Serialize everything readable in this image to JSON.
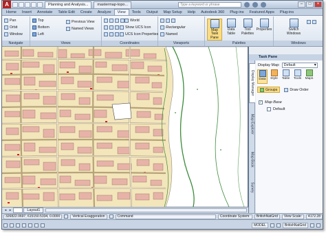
{
  "window": {
    "qat_logo": "A",
    "tab_planning": "Planning and Analysis...",
    "tab_doc": "mastermap-topo...",
    "search_placeholder": "Type a keyword or phrase"
  },
  "ribbon_tabs": [
    "Home",
    "Insert",
    "Annotate",
    "Table Edit",
    "Create",
    "Analyze",
    "View",
    "Tools",
    "Output",
    "Map Setup",
    "Help",
    "Autodesk 360",
    "Plug-ins",
    "Featured Apps",
    "Plug-ins"
  ],
  "ribbon_active_tab": "View",
  "navigate": {
    "label": "Navigate",
    "pan": "Pan",
    "orbit": "Orbit",
    "window": "Window"
  },
  "views": {
    "label": "Views",
    "top": "Top",
    "bottom": "Bottom",
    "left": "Left",
    "previous_view": "Previous View",
    "named_views": "Named Views"
  },
  "coordinates": {
    "label": "Coordinates",
    "world": "World",
    "show_ucs_icon": "Show UCS Icon",
    "ucs_icon_properties": "UCS Icon Properties"
  },
  "viewports": {
    "label": "Viewports",
    "rectangular": "Rectangular",
    "named": "Named"
  },
  "palettes": {
    "label": "Palettes",
    "map_task_pane": "Map Task Pane",
    "data_table": "Data Table",
    "tool_palettes": "Tool Palettes",
    "properties": "Properties"
  },
  "windows": {
    "label": "Windows",
    "switch_windows": "Switch Windows"
  },
  "layout_tabs": [
    "Layout1"
  ],
  "task_pane": {
    "title": "Task Pane",
    "side_tabs": [
      "Display Manager",
      "Map Explorer",
      "Map Book",
      "Survey"
    ],
    "display_map_label": "Display Map:",
    "display_map_value": "Default",
    "tools": [
      "Data",
      "Style",
      "Table",
      "Tools",
      "Maps"
    ],
    "groups_button": "Groups",
    "draw_order_button": "Draw Order",
    "tree": [
      {
        "label": "Map Base",
        "checked": true
      },
      {
        "label": "Default",
        "checked": false
      }
    ]
  },
  "command_line": {
    "coords": "326822.0697, 615150.5334, 0.0000",
    "vertical_exaggeration": "Vertical Exaggeration",
    "command": "Command",
    "coordinate_system": "Coordinate System:",
    "coordinate_system_value": "BritishNatGrid",
    "view_scale": "View Scale:",
    "view_scale_value": "4172.28",
    "model": "MODEL",
    "coord_system_short": "BritishNatGrid"
  }
}
